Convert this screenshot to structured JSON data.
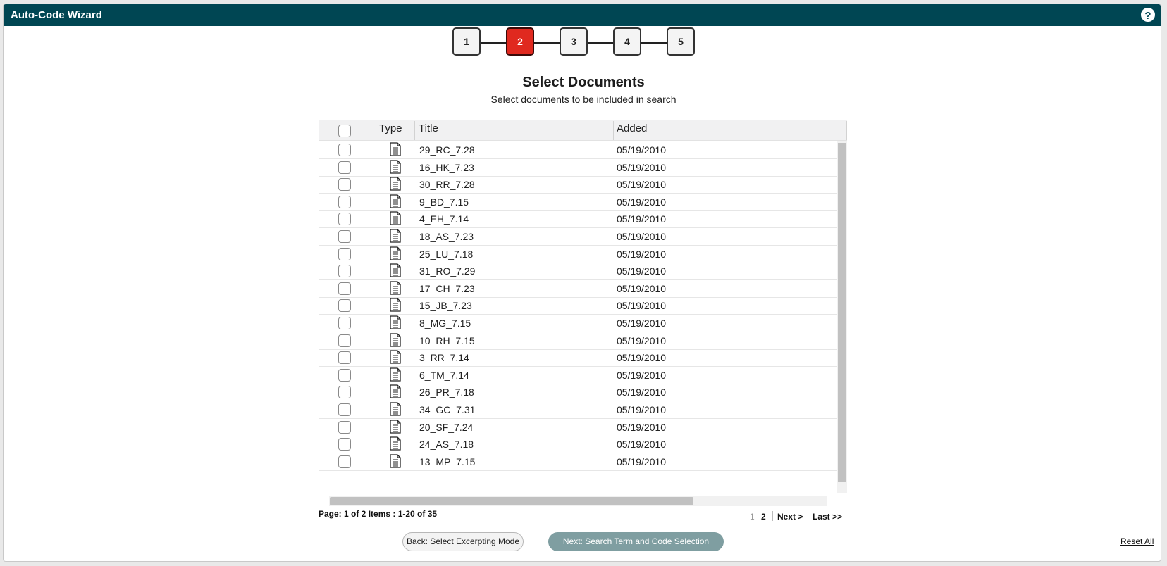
{
  "window": {
    "title": "Auto-Code Wizard",
    "help_icon": "?"
  },
  "stepper": {
    "steps": [
      "1",
      "2",
      "3",
      "4",
      "5"
    ],
    "active_step": "2"
  },
  "page": {
    "heading": "Select Documents",
    "subheading": "Select documents to be included in search"
  },
  "grid": {
    "columns": {
      "type": "Type",
      "title": "Title",
      "added": "Added"
    },
    "rows": [
      {
        "title": "29_RC_7.28",
        "added": "05/19/2010"
      },
      {
        "title": "16_HK_7.23",
        "added": "05/19/2010"
      },
      {
        "title": "30_RR_7.28",
        "added": "05/19/2010"
      },
      {
        "title": "9_BD_7.15",
        "added": "05/19/2010"
      },
      {
        "title": "4_EH_7.14",
        "added": "05/19/2010"
      },
      {
        "title": "18_AS_7.23",
        "added": "05/19/2010"
      },
      {
        "title": "25_LU_7.18",
        "added": "05/19/2010"
      },
      {
        "title": "31_RO_7.29",
        "added": "05/19/2010"
      },
      {
        "title": "17_CH_7.23",
        "added": "05/19/2010"
      },
      {
        "title": "15_JB_7.23",
        "added": "05/19/2010"
      },
      {
        "title": "8_MG_7.15",
        "added": "05/19/2010"
      },
      {
        "title": "10_RH_7.15",
        "added": "05/19/2010"
      },
      {
        "title": "3_RR_7.14",
        "added": "05/19/2010"
      },
      {
        "title": "6_TM_7.14",
        "added": "05/19/2010"
      },
      {
        "title": "26_PR_7.18",
        "added": "05/19/2010"
      },
      {
        "title": "34_GC_7.31",
        "added": "05/19/2010"
      },
      {
        "title": "20_SF_7.24",
        "added": "05/19/2010"
      },
      {
        "title": "24_AS_7.18",
        "added": "05/19/2010"
      },
      {
        "title": "13_MP_7.15",
        "added": "05/19/2010"
      }
    ],
    "row_icon": "document-icon"
  },
  "pagination": {
    "info": "Page: 1 of 2 Items : 1-20 of 35",
    "page1": "1",
    "page2": "2",
    "next": "Next >",
    "last": "Last >>"
  },
  "buttons": {
    "back": "Back: Select Excerpting Mode",
    "next": "Next: Search Term and Code Selection",
    "reset": "Reset All"
  },
  "colors": {
    "titlebar": "#004653",
    "active_step": "#e0291f",
    "next_button": "#7f9ea1"
  }
}
